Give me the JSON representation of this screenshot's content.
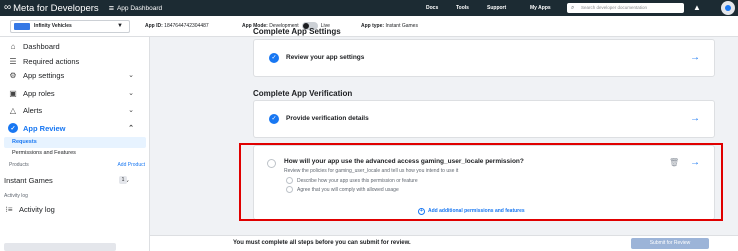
{
  "header": {
    "brand": "Meta for Developers",
    "section_title": "App Dashboard",
    "nav": [
      "Docs",
      "Tools",
      "Support",
      "My Apps"
    ],
    "search_placeholder": "Search developer documentation"
  },
  "app_bar": {
    "app_name": "Infinity Vehicles",
    "app_id_label": "App ID:",
    "app_id": "1847644742304487",
    "app_mode_label": "App Mode:",
    "app_mode_dev": "Development",
    "app_mode_live": "Live",
    "app_type_label": "App type:",
    "app_type": "Instant Games"
  },
  "sidebar": {
    "items": [
      {
        "label": "Dashboard",
        "icon": "house-icon"
      },
      {
        "label": "Required actions",
        "icon": "list-icon"
      },
      {
        "label": "App settings",
        "icon": "gear-icon"
      },
      {
        "label": "App roles",
        "icon": "people-icon"
      },
      {
        "label": "Alerts",
        "icon": "bell-icon"
      },
      {
        "label": "App Review",
        "icon": "check-circle-icon"
      }
    ],
    "review_subitems": [
      "Requests",
      "Permissions and Features"
    ],
    "products_heading": "Products",
    "add_product": "Add Product",
    "instant_games": "Instant Games",
    "instant_games_badge": "1",
    "activity_heading": "Activity log",
    "activity_log": "Activity log"
  },
  "main": {
    "settings_heading": "Complete App Settings",
    "settings_card": "Review your app settings",
    "verification_heading": "Complete App Verification",
    "verification_card": "Provide verification details",
    "permission": {
      "question": "How will your app use the advanced access gaming_user_locale permission?",
      "subtitle": "Review the policies for gaming_user_locale and tell us how you intend to use it",
      "steps": [
        "Describe how your app uses this permission or feature",
        "Agree that you will comply with allowed usage"
      ],
      "add_more": "Add additional permissions and features"
    }
  },
  "footer": {
    "message": "You must complete all steps before you can submit for review.",
    "submit": "Submit for Review"
  }
}
